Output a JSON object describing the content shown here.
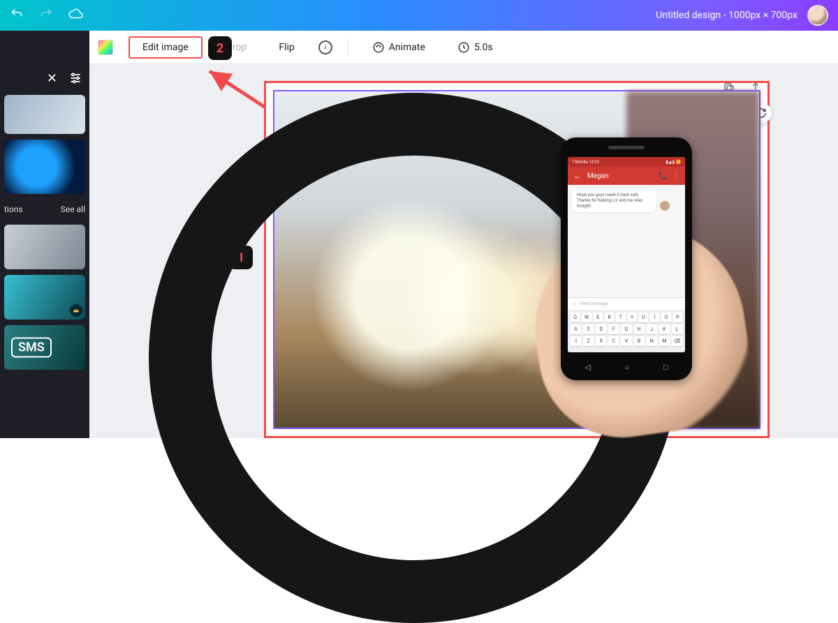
{
  "document_title": "Untitled design - 1000px × 700px",
  "toolbar": {
    "edit_image": "Edit image",
    "crop": "Crop",
    "flip": "Flip",
    "animate": "Animate",
    "duration": "5.0s"
  },
  "sidepanel": {
    "section_label": "tions",
    "see_all": "See all",
    "sms_badge": "SMS"
  },
  "phone": {
    "carrier": "T-Mobile  13:02",
    "contact_name": "Megan",
    "message_text": "Hope you guys made it back safe. Thanks for helping Liz and me relax tonight!",
    "compose_placeholder": "Send message",
    "keyboard_rows": [
      [
        "Q",
        "W",
        "E",
        "R",
        "T",
        "Y",
        "U",
        "I",
        "O",
        "P"
      ],
      [
        "A",
        "S",
        "D",
        "F",
        "G",
        "H",
        "J",
        "K",
        "L"
      ],
      [
        "⇧",
        "Z",
        "X",
        "C",
        "V",
        "B",
        "N",
        "M",
        "⌫"
      ]
    ]
  },
  "annotations": {
    "label1": "1",
    "label2": "2"
  }
}
